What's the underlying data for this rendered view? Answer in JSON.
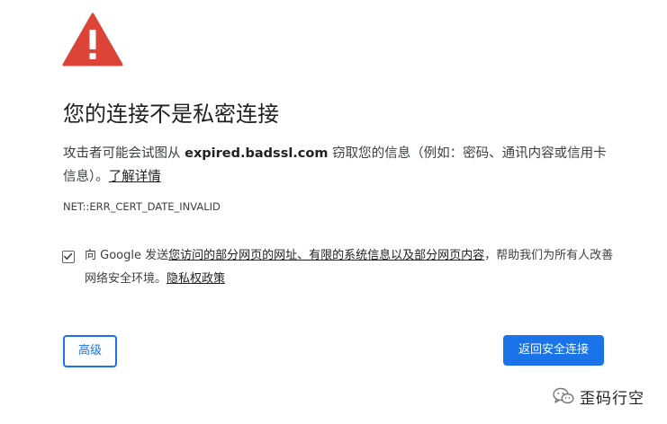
{
  "title": "您的连接不是私密连接",
  "description": {
    "before": "攻击者可能会试图从 ",
    "domain": "expired.badssl.com",
    "after": " 窃取您的信息（例如：密码、通讯内容或信用卡信息）。",
    "learn_more": "了解详情"
  },
  "error_code": "NET::ERR_CERT_DATE_INVALID",
  "optin": {
    "checked": true,
    "prefix": "向 Google 发送",
    "link": "您访问的部分网页的网址、有限的系统信息以及部分网页内容",
    "suffix": "，帮助我们为所有人改善网络安全环境。",
    "privacy_link": "隐私权政策"
  },
  "buttons": {
    "advanced": "高级",
    "back_to_safety": "返回安全连接"
  },
  "watermark": {
    "text": "歪码行空"
  },
  "colors": {
    "warning_red": "#db4437",
    "accent_blue": "#1a73e8"
  },
  "icons": {
    "warning": "warning-triangle-icon",
    "checkbox": "checkmark-icon",
    "watermark": "wechat-icon"
  }
}
